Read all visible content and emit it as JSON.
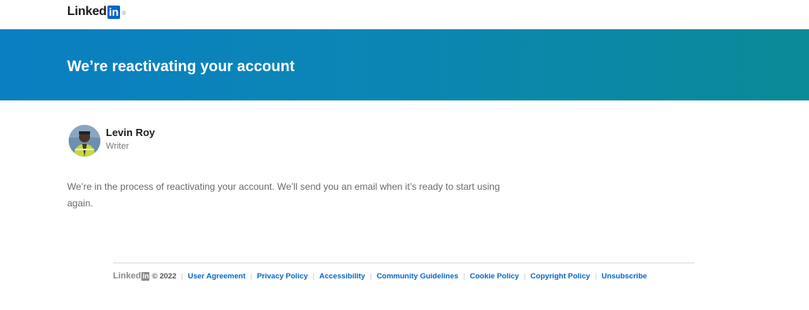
{
  "brand": {
    "logo_text": "Linked",
    "logo_box": "in",
    "logo_reg": "®"
  },
  "banner": {
    "title": "We’re reactivating your account"
  },
  "profile": {
    "name": "Levin Roy",
    "role": "Writer"
  },
  "message": "We’re in the process of reactivating your account. We’ll send you an email when it’s ready to start using again.",
  "footer": {
    "logo_text": "Linked",
    "logo_box": "in",
    "copyright": "© 2022",
    "links": [
      "User Agreement",
      "Privacy Policy",
      "Accessibility",
      "Community Guidelines",
      "Cookie Policy",
      "Copyright Policy",
      "Unsubscribe"
    ]
  },
  "colors": {
    "brand_blue": "#0a66c2",
    "banner_start": "#0a7fc2",
    "banner_end": "#0b8a98"
  }
}
